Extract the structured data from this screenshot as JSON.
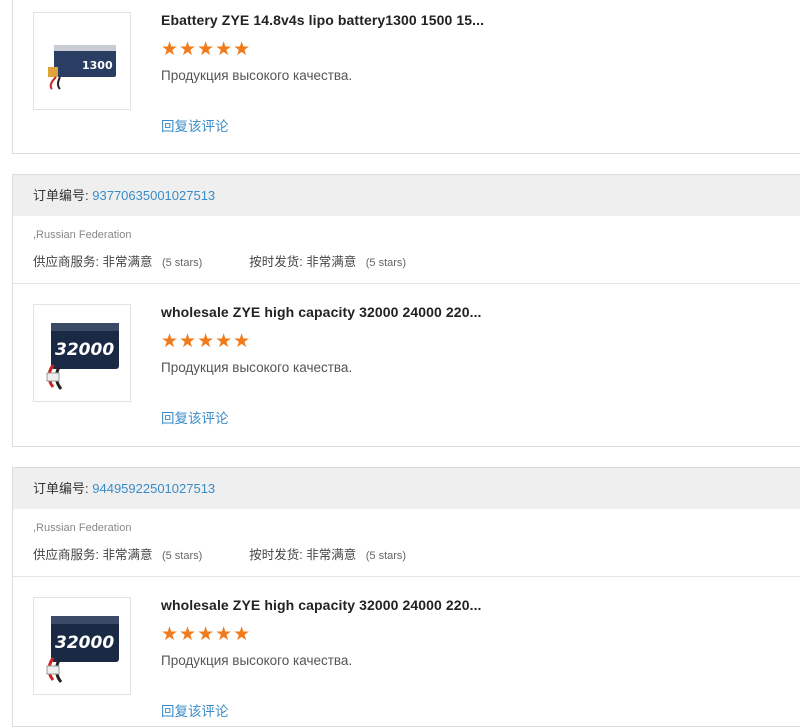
{
  "products": [
    {
      "title": "Ebattery ZYE 14.8v4s lipo battery1300 1500 15...",
      "review": "Продукция высокого качества.",
      "reply_label": "回复该评论",
      "thumb_text": "1300"
    },
    {
      "title": "wholesale ZYE high capacity 32000 24000 220...",
      "review": "Продукция высокого качества.",
      "reply_label": "回复该评论",
      "thumb_text": "32000"
    },
    {
      "title": "wholesale ZYE high capacity 32000 24000 220...",
      "review": "Продукция высокого качества.",
      "reply_label": "回复该评论",
      "thumb_text": "32000"
    }
  ],
  "rating_stars": "★★★★★",
  "orders": [
    {
      "label": "订单编号:",
      "number": "93770635001027513",
      "country": ",Russian Federation",
      "supplier_label": "供应商服务:",
      "supplier_value": "非常满意",
      "supplier_stars": "(5 stars)",
      "delivery_label": "按时发货:",
      "delivery_value": "非常满意",
      "delivery_stars": "(5 stars)"
    },
    {
      "label": "订单编号:",
      "number": "94495922501027513",
      "country": ",Russian Federation",
      "supplier_label": "供应商服务:",
      "supplier_value": "非常满意",
      "supplier_stars": "(5 stars)",
      "delivery_label": "按时发货:",
      "delivery_value": "非常满意",
      "delivery_stars": "(5 stars)"
    }
  ],
  "colors": {
    "accent_link": "#3a8cc8",
    "star": "#f07b1c",
    "header_bg": "#efefef"
  }
}
